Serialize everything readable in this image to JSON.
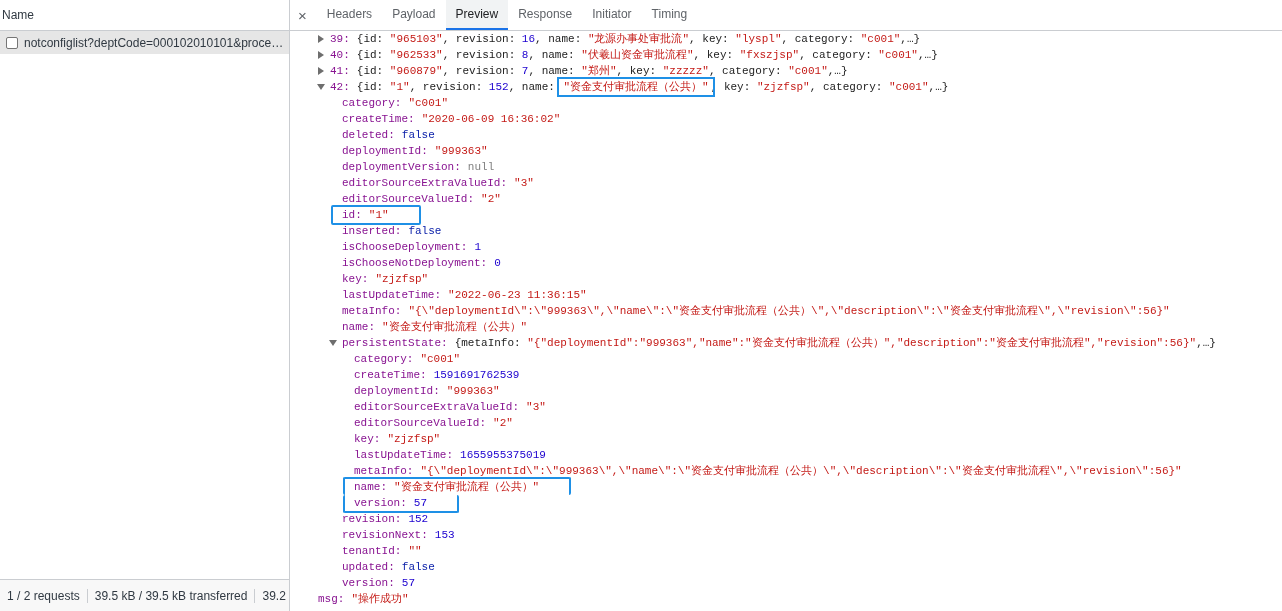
{
  "requests_panel": {
    "column_header": "Name",
    "requests": [
      {
        "name": "notconfiglist?deptCode=000102010101&proce…",
        "selected": true,
        "checked": false
      }
    ],
    "status_bar": [
      "1 / 2 requests",
      "39.5 kB / 39.5 kB transferred",
      "39.2"
    ]
  },
  "detail_panel": {
    "close": "×",
    "tabs": [
      {
        "label": "Headers",
        "selected": false
      },
      {
        "label": "Payload",
        "selected": false
      },
      {
        "label": "Preview",
        "selected": true
      },
      {
        "label": "Response",
        "selected": false
      },
      {
        "label": "Initiator",
        "selected": false
      },
      {
        "label": "Timing",
        "selected": false
      }
    ],
    "preview": {
      "items": [
        {
          "key": "39:",
          "expanded": false,
          "summary": [
            {
              "text": "{id: ",
              "kind": "plain"
            },
            {
              "text": "\"965103\"",
              "kind": "string"
            },
            {
              "text": ", revision: ",
              "kind": "plain"
            },
            {
              "text": "16",
              "kind": "number"
            },
            {
              "text": ", name: ",
              "kind": "plain"
            },
            {
              "text": "\"龙源办事处审批流\"",
              "kind": "string"
            },
            {
              "text": ", key: ",
              "kind": "plain"
            },
            {
              "text": "\"lyspl\"",
              "kind": "string"
            },
            {
              "text": ", category: ",
              "kind": "plain"
            },
            {
              "text": "\"c001\"",
              "kind": "string"
            },
            {
              "text": ",…}",
              "kind": "plain"
            }
          ]
        },
        {
          "key": "40:",
          "expanded": false,
          "summary": [
            {
              "text": "{id: ",
              "kind": "plain"
            },
            {
              "text": "\"962533\"",
              "kind": "string"
            },
            {
              "text": ", revision: ",
              "kind": "plain"
            },
            {
              "text": "8",
              "kind": "number"
            },
            {
              "text": ", name: ",
              "kind": "plain"
            },
            {
              "text": "\"伏羲山资金审批流程\"",
              "kind": "string"
            },
            {
              "text": ", key: ",
              "kind": "plain"
            },
            {
              "text": "\"fxszjsp\"",
              "kind": "string"
            },
            {
              "text": ", category: ",
              "kind": "plain"
            },
            {
              "text": "\"c001\"",
              "kind": "string"
            },
            {
              "text": ",…}",
              "kind": "plain"
            }
          ]
        },
        {
          "key": "41:",
          "expanded": false,
          "summary": [
            {
              "text": "{id: ",
              "kind": "plain"
            },
            {
              "text": "\"960879\"",
              "kind": "string"
            },
            {
              "text": ", revision: ",
              "kind": "plain"
            },
            {
              "text": "7",
              "kind": "number"
            },
            {
              "text": ", name: ",
              "kind": "plain"
            },
            {
              "text": "\"郑州\"",
              "kind": "string"
            },
            {
              "text": ", key: ",
              "kind": "plain"
            },
            {
              "text": "\"zzzzz\"",
              "kind": "string"
            },
            {
              "text": ", category: ",
              "kind": "plain"
            },
            {
              "text": "\"c001\"",
              "kind": "string"
            },
            {
              "text": ",…}",
              "kind": "plain"
            }
          ]
        },
        {
          "key": "42:",
          "expanded": true,
          "summary": [
            {
              "text": "{id: ",
              "kind": "plain"
            },
            {
              "text": "\"1\"",
              "kind": "string"
            },
            {
              "text": ", revision: ",
              "kind": "plain"
            },
            {
              "text": "152",
              "kind": "number"
            },
            {
              "text": ", name: ",
              "kind": "plain"
            },
            {
              "text": "\"资金支付审批流程（公共）\"",
              "kind": "string",
              "highlighted": true
            },
            {
              "text": ", key: ",
              "kind": "plain"
            },
            {
              "text": "\"zjzfsp\"",
              "kind": "string"
            },
            {
              "text": ", category: ",
              "kind": "plain"
            },
            {
              "text": "\"c001\"",
              "kind": "string"
            },
            {
              "text": ",…}",
              "kind": "plain"
            }
          ],
          "children": [
            {
              "key": "category:",
              "value": "\"c001\"",
              "kind": "string"
            },
            {
              "key": "createTime:",
              "value": "\"2020-06-09 16:36:02\"",
              "kind": "string"
            },
            {
              "key": "deleted:",
              "value": "false",
              "kind": "keyword"
            },
            {
              "key": "deploymentId:",
              "value": "\"999363\"",
              "kind": "string"
            },
            {
              "key": "deploymentVersion:",
              "value": "null",
              "kind": "null"
            },
            {
              "key": "editorSourceExtraValueId:",
              "value": "\"3\"",
              "kind": "string"
            },
            {
              "key": "editorSourceValueId:",
              "value": "\"2\"",
              "kind": "string"
            },
            {
              "key": "id:",
              "value": "\"1\"",
              "kind": "string",
              "highlighted": true
            },
            {
              "key": "inserted:",
              "value": "false",
              "kind": "keyword"
            },
            {
              "key": "isChooseDeployment:",
              "value": "1",
              "kind": "number"
            },
            {
              "key": "isChooseNotDeployment:",
              "value": "0",
              "kind": "number"
            },
            {
              "key": "key:",
              "value": "\"zjzfsp\"",
              "kind": "string"
            },
            {
              "key": "lastUpdateTime:",
              "value": "\"2022-06-23 11:36:15\"",
              "kind": "string"
            },
            {
              "key": "metaInfo:",
              "value": "\"{\\\"deploymentId\\\":\\\"999363\\\",\\\"name\\\":\\\"资金支付审批流程（公共）\\\",\\\"description\\\":\\\"资金支付审批流程\\\",\\\"revision\\\":56}\"",
              "kind": "string"
            },
            {
              "key": "name:",
              "value": "\"资金支付审批流程（公共）\"",
              "kind": "string"
            },
            {
              "key": "persistentState:",
              "expanded": true,
              "summary": [
                {
                  "text": "{metaInfo: ",
                  "kind": "plain"
                },
                {
                  "text": "\"{\"deploymentId\":\"999363\",\"name\":\"资金支付审批流程（公共）\",\"description\":\"资金支付审批流程\",\"revision\":56}\"",
                  "kind": "string"
                },
                {
                  "text": ",…}",
                  "kind": "plain"
                }
              ],
              "children": [
                {
                  "key": "category:",
                  "value": "\"c001\"",
                  "kind": "string"
                },
                {
                  "key": "createTime:",
                  "value": "1591691762539",
                  "kind": "number"
                },
                {
                  "key": "deploymentId:",
                  "value": "\"999363\"",
                  "kind": "string"
                },
                {
                  "key": "editorSourceExtraValueId:",
                  "value": "\"3\"",
                  "kind": "string"
                },
                {
                  "key": "editorSourceValueId:",
                  "value": "\"2\"",
                  "kind": "string"
                },
                {
                  "key": "key:",
                  "value": "\"zjzfsp\"",
                  "kind": "string"
                },
                {
                  "key": "lastUpdateTime:",
                  "value": "1655955375019",
                  "kind": "number"
                },
                {
                  "key": "metaInfo:",
                  "value": "\"{\\\"deploymentId\\\":\\\"999363\\\",\\\"name\\\":\\\"资金支付审批流程（公共）\\\",\\\"description\\\":\\\"资金支付审批流程\\\",\\\"revision\\\":56}\"",
                  "kind": "string"
                },
                {
                  "key": "name:",
                  "value": "\"资金支付审批流程（公共）\"",
                  "kind": "string",
                  "highlighted": true
                },
                {
                  "key": "version:",
                  "value": "57",
                  "kind": "number",
                  "highlighted": true
                }
              ]
            },
            {
              "key": "revision:",
              "value": "152",
              "kind": "number"
            },
            {
              "key": "revisionNext:",
              "value": "153",
              "kind": "number"
            },
            {
              "key": "tenantId:",
              "value": "\"\"",
              "kind": "string"
            },
            {
              "key": "updated:",
              "value": "false",
              "kind": "keyword"
            },
            {
              "key": "version:",
              "value": "57",
              "kind": "number"
            }
          ]
        }
      ],
      "after": [
        {
          "key": "msg:",
          "value": "\"操作成功\"",
          "kind": "string"
        }
      ]
    }
  }
}
